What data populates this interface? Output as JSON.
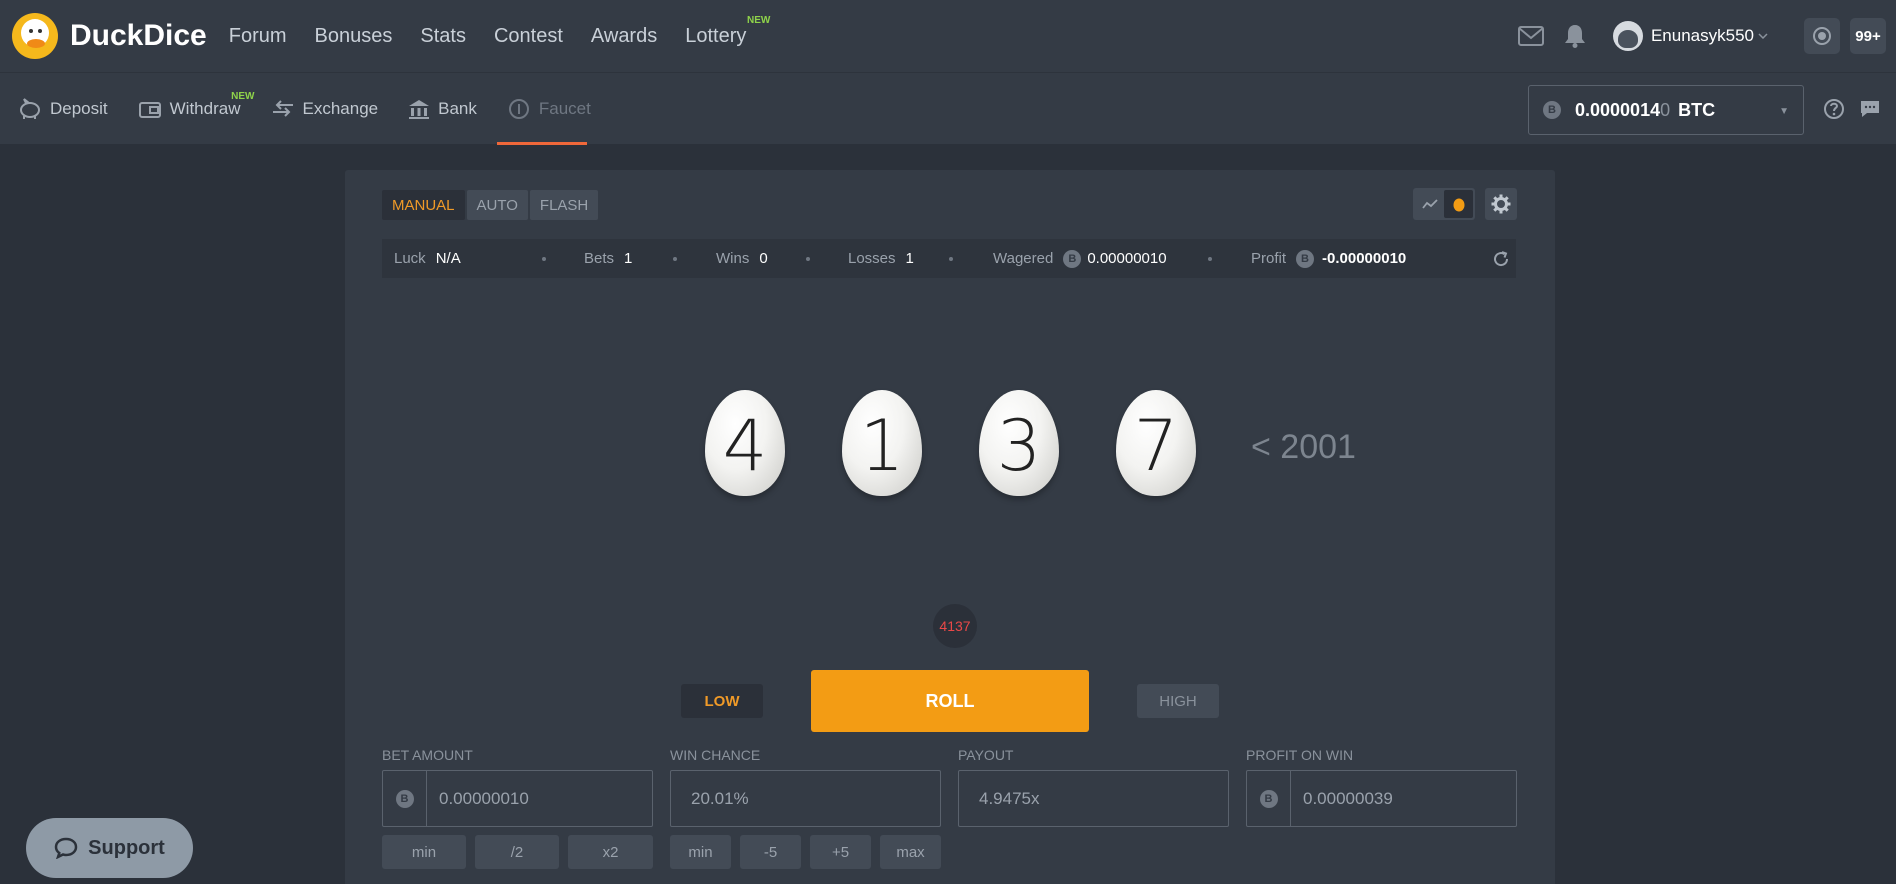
{
  "brand": {
    "name": "DuckDice"
  },
  "nav": {
    "items": [
      {
        "label": "Forum"
      },
      {
        "label": "Bonuses"
      },
      {
        "label": "Stats"
      },
      {
        "label": "Contest"
      },
      {
        "label": "Awards"
      },
      {
        "label": "Lottery",
        "badge": "NEW"
      }
    ]
  },
  "user": {
    "name": "Enunasyk550",
    "notifications": "99+"
  },
  "subnav": {
    "items": [
      {
        "label": "Deposit"
      },
      {
        "label": "Withdraw",
        "badge": "NEW"
      },
      {
        "label": "Exchange"
      },
      {
        "label": "Bank"
      },
      {
        "label": "Faucet"
      }
    ]
  },
  "balance": {
    "value": "0.0000014",
    "value_dim": "0",
    "unit": "BTC",
    "coin_icon": "B"
  },
  "modes": {
    "manual": "MANUAL",
    "auto": "AUTO",
    "flash": "FLASH"
  },
  "stats": {
    "luck": {
      "label": "Luck",
      "value": "N/A"
    },
    "bets": {
      "label": "Bets",
      "value": "1"
    },
    "wins": {
      "label": "Wins",
      "value": "0"
    },
    "losses": {
      "label": "Losses",
      "value": "1"
    },
    "wagered": {
      "label": "Wagered",
      "value": "0.00000010"
    },
    "profit": {
      "label": "Profit",
      "value": "-0.00000010"
    }
  },
  "roll": {
    "digits": [
      "4",
      "1",
      "3",
      "7"
    ],
    "target": "< 2001",
    "result": "4137"
  },
  "buttons": {
    "low": "LOW",
    "roll": "ROLL",
    "high": "HIGH"
  },
  "fields": {
    "bet_amount": {
      "label": "BET AMOUNT",
      "value": "0.00000010"
    },
    "win_chance": {
      "label": "WIN CHANCE",
      "value": "20.01%"
    },
    "payout": {
      "label": "PAYOUT",
      "value": "4.9475x"
    },
    "profit_on_win": {
      "label": "PROFIT ON WIN",
      "value": "0.00000039"
    }
  },
  "bet_buttons": {
    "min": "min",
    "half": "/2",
    "double": "x2"
  },
  "chance_buttons": {
    "min": "min",
    "minus5": "-5",
    "plus5": "+5",
    "max": "max"
  },
  "support": {
    "label": "Support"
  },
  "colors": {
    "accent": "#f39c14",
    "loss": "#e94848",
    "new_badge": "#8fd34a",
    "active_underline": "#f0683a"
  }
}
